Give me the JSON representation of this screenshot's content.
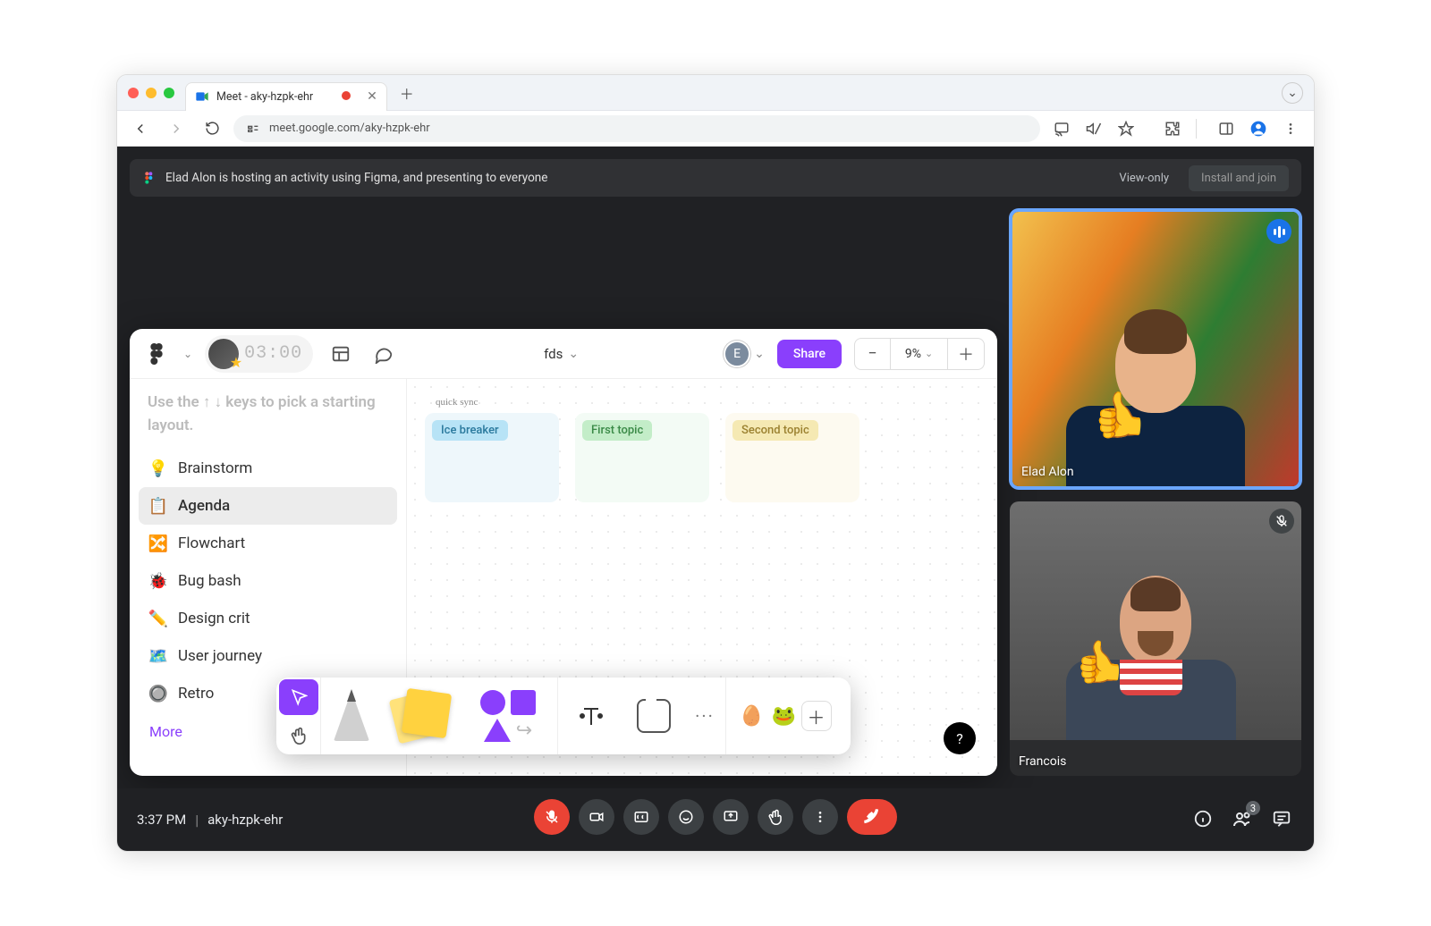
{
  "browser": {
    "tab_title": "Meet - aky-hzpk-ehr",
    "url": "meet.google.com/aky-hzpk-ehr"
  },
  "activity_bar": {
    "message": "Elad Alon is hosting an activity using Figma, and presenting to everyone",
    "view_only": "View-only",
    "install_join": "Install and join"
  },
  "figma": {
    "timer": "03:00",
    "filename": "fds",
    "avatar_letter": "E",
    "share_label": "Share",
    "zoom_percent": "9%",
    "hint": "Use the ↑ ↓ keys to pick a starting layout.",
    "templates": [
      {
        "icon": "💡",
        "label": "Brainstorm",
        "color": "#f6b73c"
      },
      {
        "icon": "📋",
        "label": "Agenda",
        "color": "#5aa9e6",
        "selected": true
      },
      {
        "icon": "🔀",
        "label": "Flowchart",
        "color": "#2ecc71"
      },
      {
        "icon": "🐞",
        "label": "Bug bash",
        "color": "#e74c3c"
      },
      {
        "icon": "✏️",
        "label": "Design crit",
        "color": "#8a3ffc"
      },
      {
        "icon": "🗺️",
        "label": "User journey",
        "color": "#5b6fd9"
      },
      {
        "icon": "🔘",
        "label": "Retro",
        "color": "#2ecc71"
      }
    ],
    "more_label": "More",
    "canvas_title": "quick sync",
    "cards": [
      "Ice breaker",
      "First topic",
      "Second topic"
    ]
  },
  "participants": [
    {
      "name": "Elad Alon",
      "speaking": true,
      "muted": false
    },
    {
      "name": "Francois",
      "speaking": false,
      "muted": true
    }
  ],
  "footer": {
    "time": "3:37 PM",
    "code": "aky-hzpk-ehr",
    "people_count": "3"
  }
}
